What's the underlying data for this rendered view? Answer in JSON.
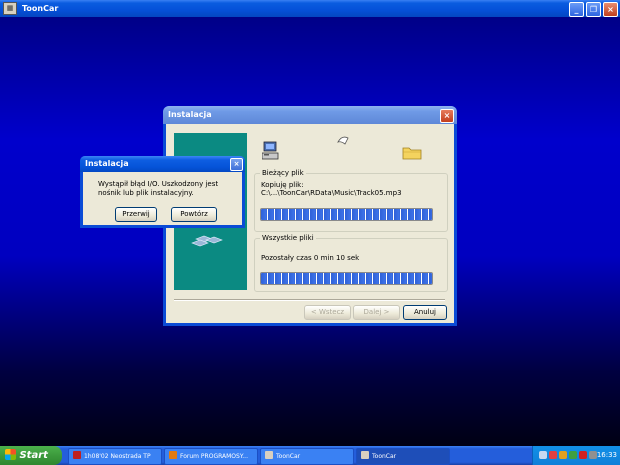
{
  "app_window": {
    "title": "ToonCar"
  },
  "installer": {
    "title": "Instalacja",
    "current_file": {
      "legend": "Bieżący plik",
      "line1": "Kopiuję plik:",
      "line2": "C:\\...\\ToonCar\\RData\\Music\\Track05.mp3",
      "progress": 1.0
    },
    "all_files": {
      "legend": "Wszystkie pliki",
      "remaining": "Pozostały czas 0 min 10 sek",
      "progress": 1.0
    },
    "buttons": {
      "back": "< Wstecz",
      "next": "Dalej >",
      "cancel": "Anuluj"
    }
  },
  "error_dialog": {
    "title": "Instalacja",
    "message": "Wystąpił błąd I/O. Uszkodzony jest nośnik lub plik instalacyjny.",
    "buttons": {
      "abort": "Przerwij",
      "retry": "Powtórz"
    }
  },
  "taskbar": {
    "start_label": "Start",
    "tasks": [
      {
        "label": "1h08'02 Neostrada TP",
        "icon_color": "#c02020"
      },
      {
        "label": "Forum PROGRAMOSY...",
        "icon_color": "#e07a10"
      },
      {
        "label": "ToonCar",
        "icon_color": "#d8d0c0"
      },
      {
        "label": "ToonCar",
        "icon_color": "#d8d0c0"
      }
    ],
    "clock": "16:33"
  }
}
